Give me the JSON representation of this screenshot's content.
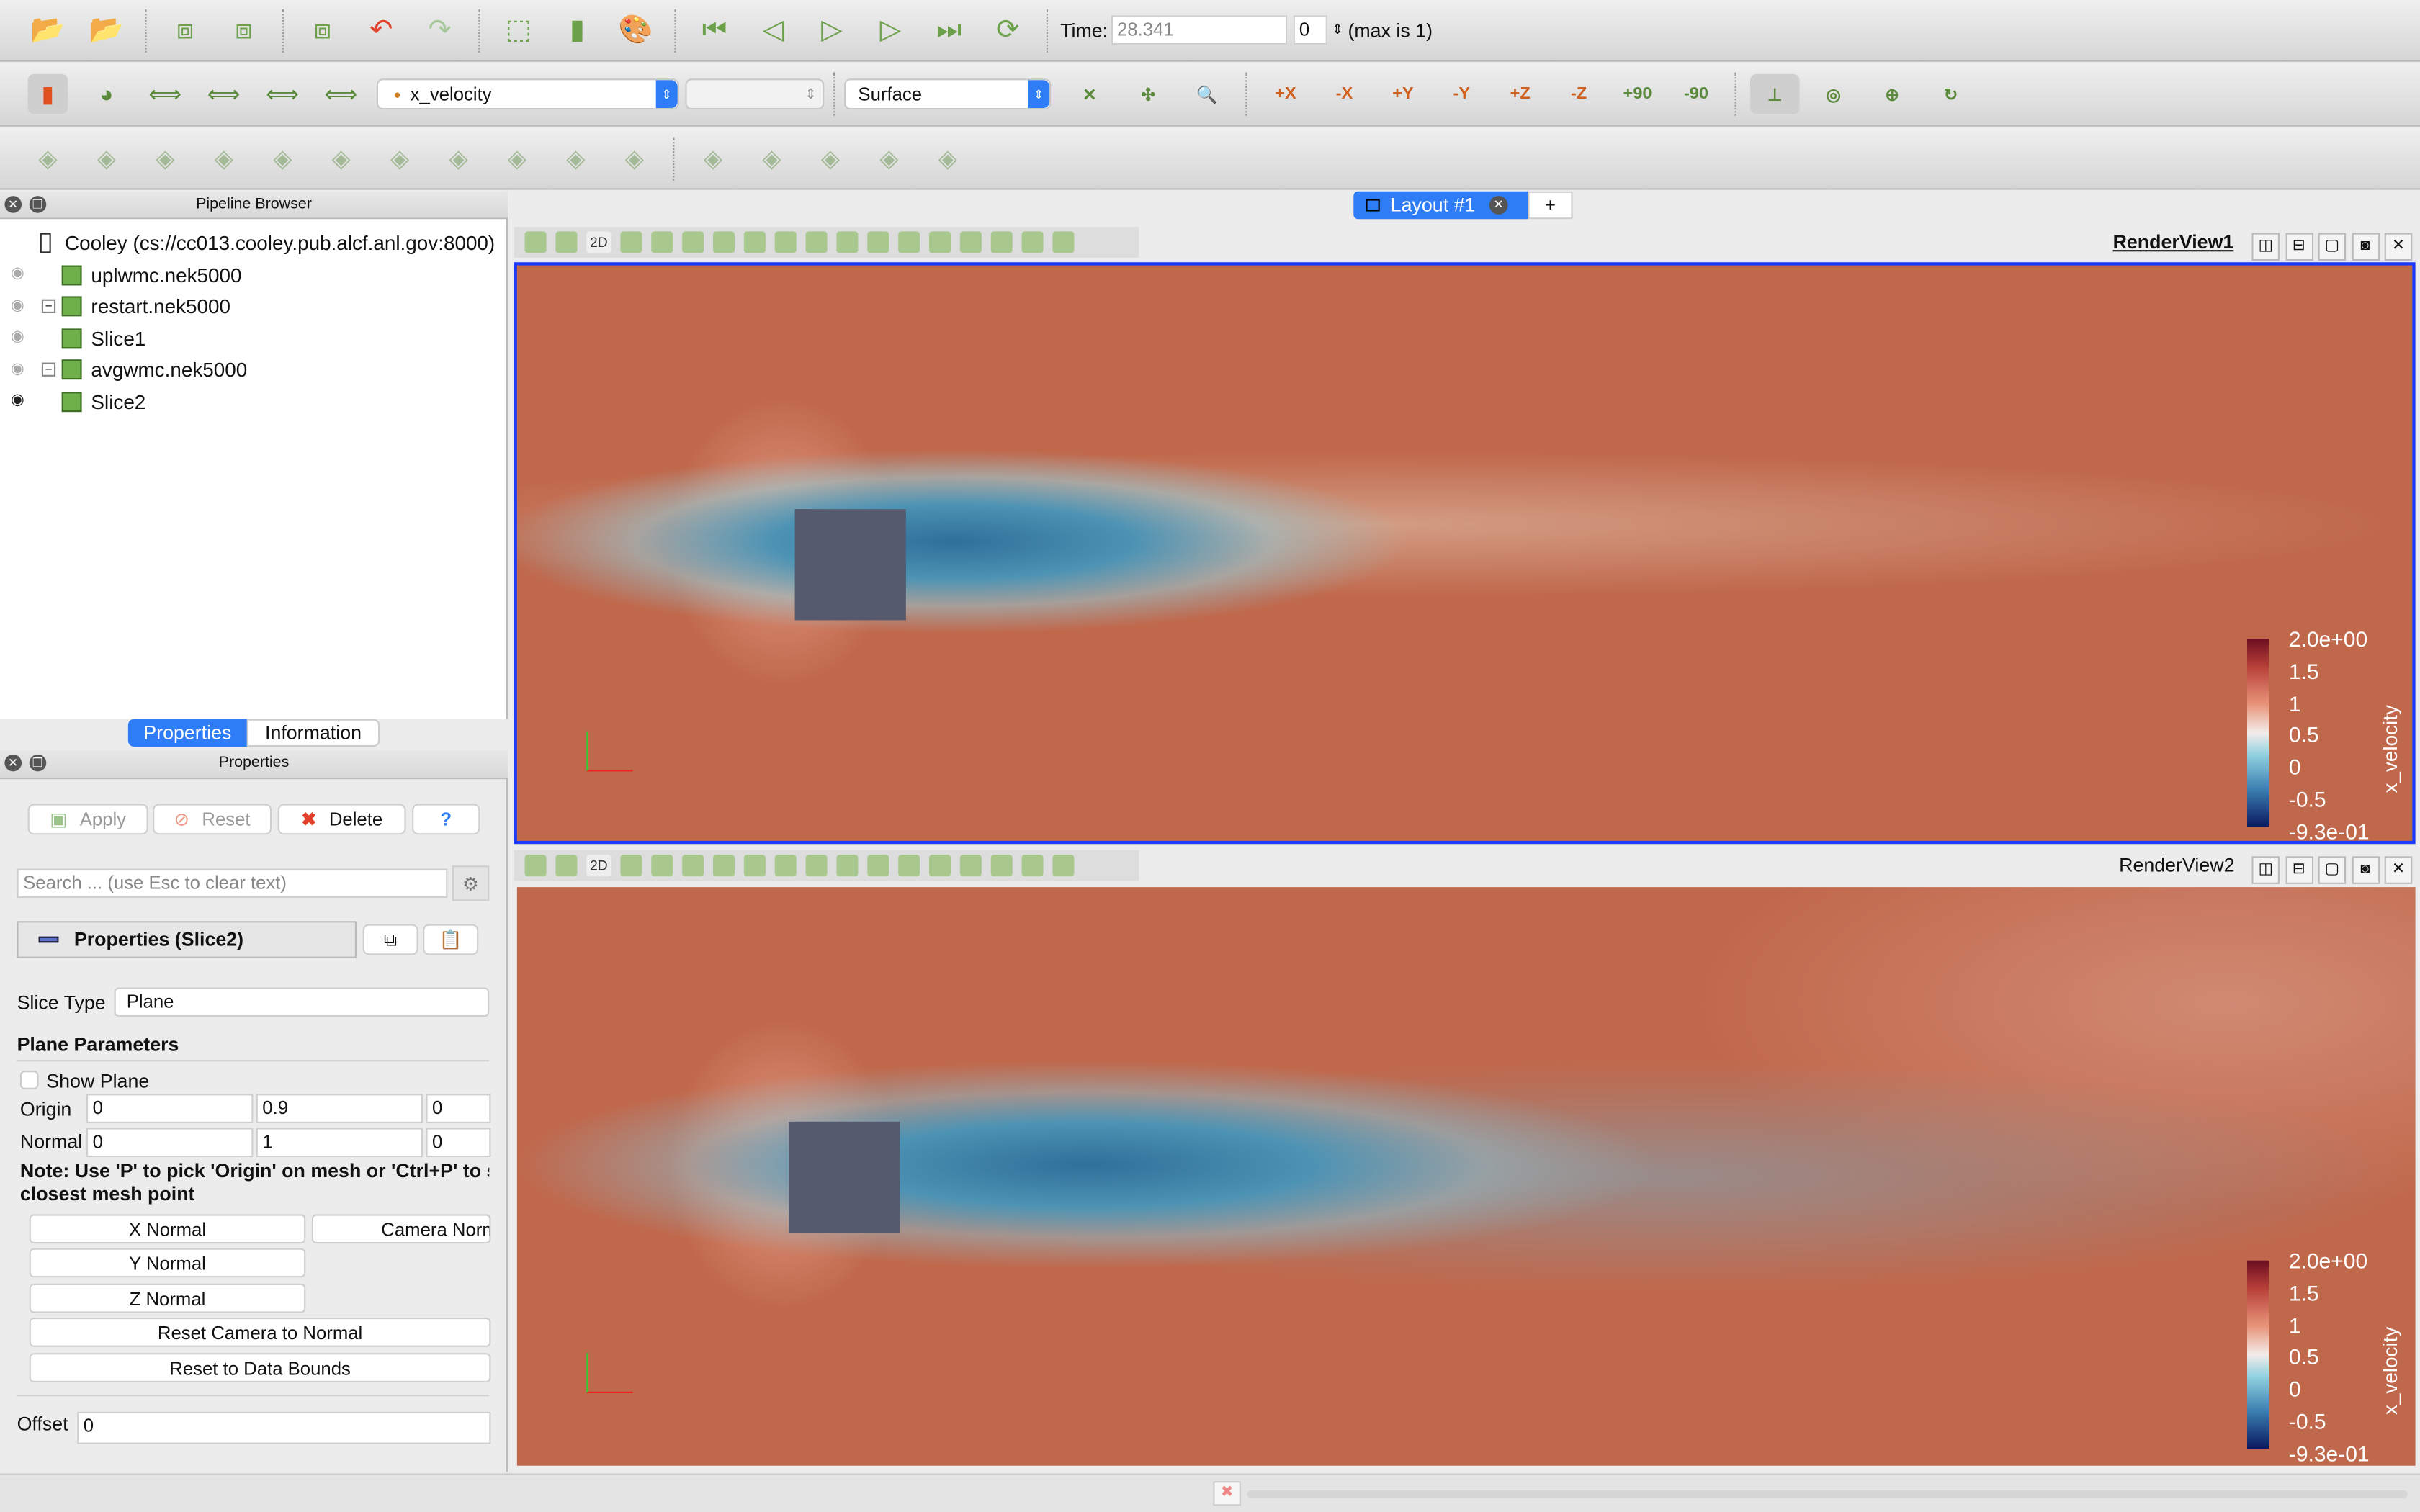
{
  "toolbar1": {
    "icons": [
      "open-icon",
      "load-state-icon",
      "save-state-icon",
      "connect-icon",
      "disconnect-icon",
      "undo-icon",
      "redo-icon",
      "reset-camera-icon",
      "color-map-icon",
      "palette-icon",
      "first-frame-icon",
      "previous-frame-icon",
      "play-icon",
      "next-frame-icon",
      "last-frame-icon",
      "loop-icon"
    ],
    "time_label": "Time:",
    "time_value": "28.341",
    "timestep_value": "0",
    "max_label": "(max is 1)"
  },
  "toolbar2": {
    "icons_left": [
      "toggle-color-legend-icon",
      "edit-color-map-icon",
      "rescale-range-icon",
      "rescale-custom-icon",
      "rescale-temporal-icon",
      "rescale-visible-icon"
    ],
    "array_select": "x_velocity",
    "component_select": "",
    "representation_select": "Surface",
    "icons_right": [
      {
        "name": "reset-camera-icon",
        "text": "✕"
      },
      {
        "name": "zoom-to-data-icon",
        "text": "✣"
      },
      {
        "name": "zoom-to-box-icon",
        "text": "🔍"
      },
      {
        "name": "view-plus-x-icon",
        "text": "+X"
      },
      {
        "name": "view-minus-x-icon",
        "text": "-X"
      },
      {
        "name": "view-plus-y-icon",
        "text": "+Y"
      },
      {
        "name": "view-minus-y-icon",
        "text": "-Y"
      },
      {
        "name": "view-plus-z-icon",
        "text": "+Z"
      },
      {
        "name": "view-minus-z-icon",
        "text": "-Z"
      },
      {
        "name": "rotate-plus-90-icon",
        "text": "+90"
      },
      {
        "name": "rotate-minus-90-icon",
        "text": "-90"
      },
      {
        "name": "show-orientation-axes-icon",
        "text": "⊥"
      },
      {
        "name": "show-center-icon",
        "text": "◎"
      },
      {
        "name": "reset-center-icon",
        "text": "⊕"
      },
      {
        "name": "pick-center-icon",
        "text": "↻"
      }
    ]
  },
  "toolbar3": {
    "icons": [
      "calculator-icon",
      "contour-icon",
      "clip-icon",
      "slice-icon",
      "threshold-icon",
      "extract-subset-icon",
      "glyph-icon",
      "stream-tracer-icon",
      "warp-by-vector-icon",
      "group-datasets-icon",
      "extract-level-icon",
      "find-data-icon",
      "plot-over-line-icon",
      "plot-selection-icon",
      "plot-data-over-time-icon",
      "axes-grid-icon"
    ]
  },
  "pipeline": {
    "title": "Pipeline Browser",
    "server": "Cooley (cs://cc013.cooley.pub.alcf.anl.gov:8000)",
    "items": [
      {
        "label": "uplwmc.nek5000",
        "visible": false,
        "expander": false
      },
      {
        "label": "restart.nek5000",
        "visible": false,
        "expander": true
      },
      {
        "label": "Slice1",
        "visible": false,
        "expander": false
      },
      {
        "label": "avgwmc.nek5000",
        "visible": false,
        "expander": true
      },
      {
        "label": "Slice2",
        "visible": true,
        "expander": false
      }
    ]
  },
  "tabs": {
    "properties": "Properties",
    "information": "Information"
  },
  "properties": {
    "title": "Properties",
    "apply": "Apply",
    "reset": "Reset",
    "delete": "Delete",
    "help": "?",
    "search_placeholder": "Search ... (use Esc to clear text)",
    "section": "Properties (Slice2)",
    "slice_type_label": "Slice Type",
    "slice_type": "Plane",
    "plane_params": "Plane Parameters",
    "show_plane": "Show Plane",
    "origin_label": "Origin",
    "origin": [
      "0",
      "0.9",
      "0"
    ],
    "normal_label": "Normal",
    "normal": [
      "0",
      "1",
      "0"
    ],
    "note_line1": "Note: Use 'P' to pick 'Origin' on mesh or 'Ctrl+P' to s",
    "note_line2": "closest mesh point",
    "x_normal": "X Normal",
    "camera_normal": "Camera Normal",
    "y_normal": "Y Normal",
    "z_normal": "Z Normal",
    "reset_camera_normal": "Reset Camera to Normal",
    "reset_bounds": "Reset to Data Bounds",
    "offset_label": "Offset",
    "offset": "0"
  },
  "layout": {
    "tab": "Layout #1",
    "add": "+"
  },
  "views": [
    {
      "title": "RenderView1",
      "active": true
    },
    {
      "title": "RenderView2",
      "active": false
    }
  ],
  "view_toolbar_2d": "2D",
  "colorbar": {
    "title": "x_velocity",
    "labels": [
      "2.0e+00",
      "1.5",
      "1",
      "0.5",
      "0",
      "-0.5",
      "-9.3e-01"
    ],
    "range": [
      -0.93,
      2.0
    ]
  },
  "colors": {
    "accent": "#2f7df6",
    "field_bg": "#c0684c",
    "wake": "#3d7fa6",
    "obstacle": "#555a6e",
    "active_border": "#1a3cff"
  }
}
